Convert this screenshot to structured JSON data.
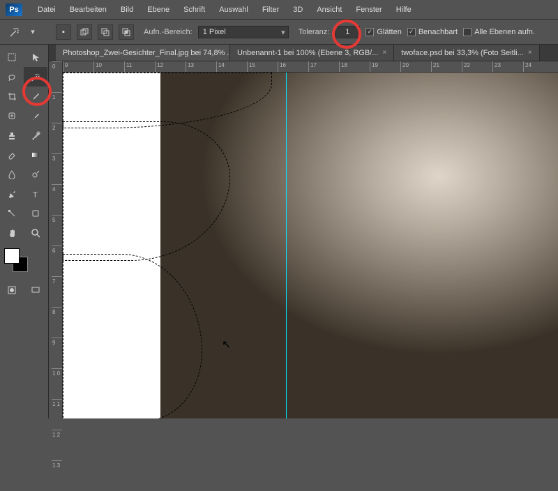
{
  "app": {
    "name": "Ps"
  },
  "menu": [
    "Datei",
    "Bearbeiten",
    "Bild",
    "Ebene",
    "Schrift",
    "Auswahl",
    "Filter",
    "3D",
    "Ansicht",
    "Fenster",
    "Hilfe"
  ],
  "options": {
    "aufn_bereich_label": "Aufn.-Bereich:",
    "aufn_bereich_value": "1 Pixel",
    "toleranz_label": "Toleranz:",
    "toleranz_value": "1",
    "glaetten": "Glätten",
    "benachbart": "Benachbart",
    "alle_ebenen": "Alle Ebenen aufn."
  },
  "tabs": [
    {
      "label": "Photoshop_Zwei-Gesichter_Final.jpg bei 74,8% ...",
      "active": true
    },
    {
      "label": "Unbenannt-1 bei 100% (Ebene 3, RGB/...",
      "active": false
    },
    {
      "label": "twoface.psd bei 33,3% (Foto Seitli...",
      "active": false
    }
  ],
  "ruler_h": [
    "9",
    "10",
    "11",
    "12",
    "13",
    "14",
    "15",
    "16",
    "17",
    "18",
    "19",
    "20",
    "21",
    "22",
    "23",
    "24"
  ],
  "ruler_v": [
    "0",
    "1",
    "2",
    "3",
    "4",
    "5",
    "6",
    "7",
    "8",
    "9",
    "1 0",
    "1 1",
    "1 2",
    "1 3"
  ],
  "tools": {
    "rows": [
      [
        "marquee",
        "arrow"
      ],
      [
        "lasso",
        "wand"
      ],
      [
        "crop",
        "eyedrop"
      ],
      [
        "heal",
        "brush"
      ],
      [
        "stamp",
        "history"
      ],
      [
        "eraser",
        "gradient"
      ],
      [
        "blur",
        "dodge"
      ],
      [
        "pen",
        "type"
      ],
      [
        "path",
        "shape"
      ],
      [
        "hand",
        "zoom"
      ]
    ],
    "selected": "wand"
  },
  "swatch": {
    "fg": "#ffffff",
    "bg": "#000000"
  }
}
